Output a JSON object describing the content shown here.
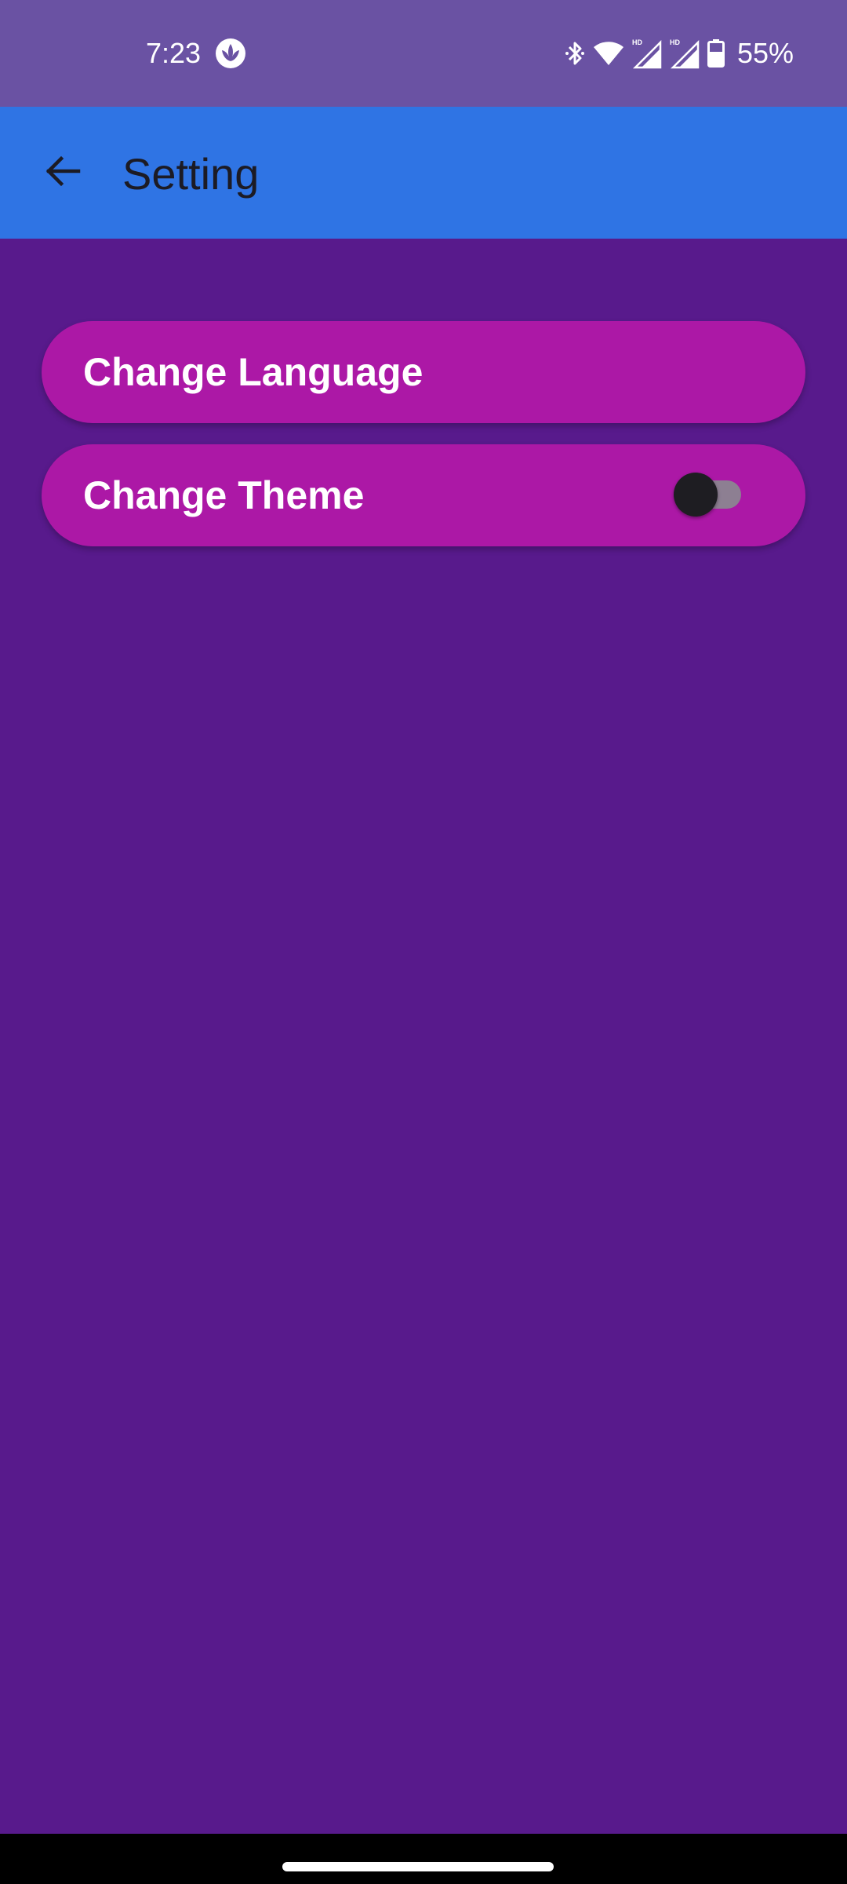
{
  "status_bar": {
    "time": "7:23",
    "battery": "55%",
    "icons": [
      "leaf-app-icon",
      "bluetooth-icon",
      "wifi-icon",
      "hd-signal-icon",
      "hd-signal-icon",
      "battery-icon"
    ]
  },
  "app_bar": {
    "title": "Setting",
    "back_icon": "arrow-left-icon"
  },
  "settings": {
    "change_language": {
      "label": "Change Language"
    },
    "change_theme": {
      "label": "Change Theme",
      "toggle_on": false
    }
  },
  "colors": {
    "status_bar": "#6a52a3",
    "app_bar": "#2f74e4",
    "background": "#581a8c",
    "card": "#ac18a6",
    "toggle_thumb": "#1e1d22",
    "toggle_track": "#8d7f92"
  }
}
